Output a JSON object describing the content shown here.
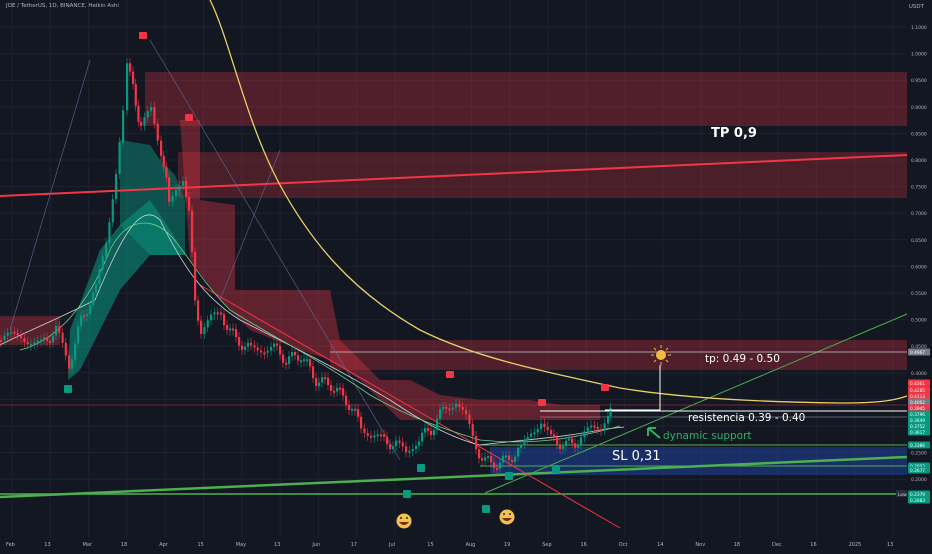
{
  "header": {
    "title": "JOE / TetherUS, 1D, BINANCE, Heikin Ashi",
    "quote_currency": "USDT"
  },
  "annotations": {
    "tp_main": "TP 0,9",
    "tp_range": "tp: 0.49 - 0.50",
    "resistance": "resistencia 0.39 - 0.40",
    "dynamic_support": "dynamic support",
    "stop_loss": "SL 0,31"
  },
  "price_axis": {
    "ticks": [
      "1.1000",
      "1.0000",
      "0.9500",
      "0.9000",
      "0.8500",
      "0.8000",
      "0.7500",
      "0.7000",
      "0.6500",
      "0.6000",
      "0.5500",
      "0.5000",
      "0.4500",
      "0.4000",
      "0.3500",
      "0.3000",
      "0.2500",
      "0.2000"
    ],
    "badges": [
      {
        "value": "0.4967",
        "color": "#787b86"
      },
      {
        "value": "0.4361",
        "color": "#f23645"
      },
      {
        "value": "0.4285",
        "color": "#f23645"
      },
      {
        "value": "0.4113",
        "color": "#f23645"
      },
      {
        "value": "0.4002",
        "color": "#787b86"
      },
      {
        "value": "0.3945",
        "color": "#f23645"
      },
      {
        "value": "0.3796",
        "color": "#089981"
      },
      {
        "value": "0.3649",
        "color": "#089981"
      },
      {
        "value": "0.3752",
        "color": "#089981"
      },
      {
        "value": "0.3617",
        "color": "#089981"
      },
      {
        "value": "0.3386",
        "color": "#089981"
      },
      {
        "value": "0.3002",
        "color": "#089981"
      },
      {
        "value": "0.2677",
        "color": "#089981"
      },
      {
        "value": "0.2379",
        "color": "#089981"
      },
      {
        "value": "0.2083",
        "color": "#089981"
      }
    ],
    "low_tag": "Low"
  },
  "time_axis": {
    "ticks": [
      "Feb",
      "13",
      "Mar",
      "18",
      "Apr",
      "15",
      "May",
      "13",
      "Jun",
      "17",
      "Jul",
      "15",
      "Aug",
      "19",
      "Sep",
      "16",
      "Oct",
      "14",
      "Nov",
      "18",
      "Dec",
      "16",
      "2025",
      "13"
    ]
  },
  "colors": {
    "background": "#131722",
    "bull": "#089981",
    "bear": "#f23645",
    "ema": "#e8d06a",
    "zone_red": "#f23645",
    "zone_blue": "#2962ff",
    "trend_green": "#4caf50",
    "resistance_line": "#ff5252"
  }
}
